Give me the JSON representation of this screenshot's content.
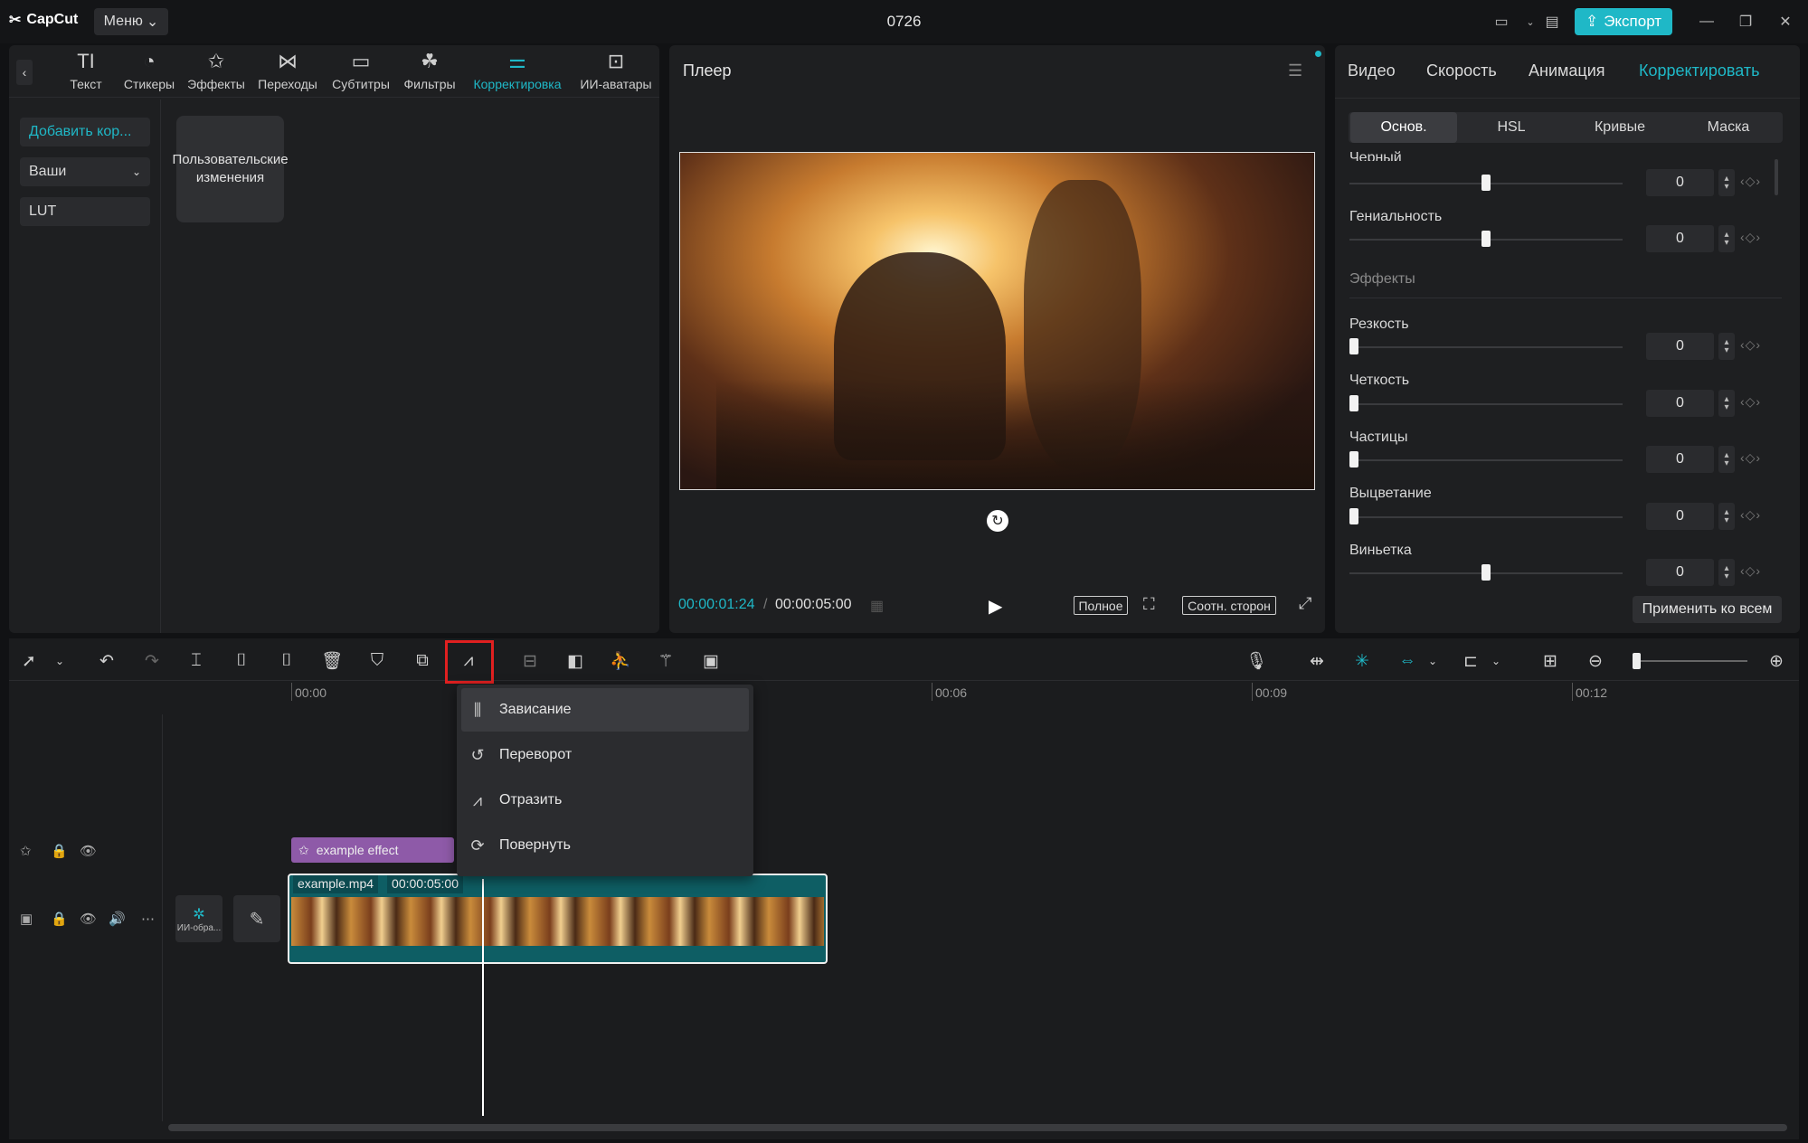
{
  "app": {
    "name": "CapCut",
    "menu_label": "Меню",
    "project_title": "0726",
    "export_label": "Экспорт"
  },
  "toolbar": {
    "items": [
      {
        "label": "Текст",
        "icon": "text-icon"
      },
      {
        "label": "Стикеры",
        "icon": "sticker-icon"
      },
      {
        "label": "Эффекты",
        "icon": "effects-icon"
      },
      {
        "label": "Переходы",
        "icon": "transitions-icon"
      },
      {
        "label": "Субтитры",
        "icon": "subtitles-icon"
      },
      {
        "label": "Фильтры",
        "icon": "filters-icon"
      },
      {
        "label": "Корректировка",
        "icon": "adjust-icon",
        "active": true
      },
      {
        "label": "ИИ-аватары",
        "icon": "avatar-icon"
      }
    ]
  },
  "leftnav": {
    "add_label": "Добавить кор...",
    "yours_label": "Ваши",
    "lut_label": "LUT"
  },
  "preset_tile": {
    "label": "Пользовательские изменения"
  },
  "player": {
    "title": "Плеер",
    "current_time": "00:00:01:24",
    "total_time": "00:00:05:00",
    "full_label": "Полное",
    "ratio_label": "Соотн. сторон"
  },
  "right": {
    "tabs": [
      "Видео",
      "Скорость",
      "Анимация",
      "Корректировать"
    ],
    "active_tab": "Корректировать",
    "subtabs": [
      "Основ.",
      "HSL",
      "Кривые",
      "Маска"
    ],
    "props_top": [
      {
        "label": "Черный",
        "value": "0",
        "pos": 0.5
      },
      {
        "label": "Гениальность",
        "value": "0",
        "pos": 0.5
      }
    ],
    "section_effects": "Эффекты",
    "props_effects": [
      {
        "label": "Резкость",
        "value": "0",
        "pos": 0
      },
      {
        "label": "Четкость",
        "value": "0",
        "pos": 0
      },
      {
        "label": "Частицы",
        "value": "0",
        "pos": 0
      },
      {
        "label": "Выцветание",
        "value": "0",
        "pos": 0
      },
      {
        "label": "Виньетка",
        "value": "0",
        "pos": 0.5
      }
    ],
    "apply_all": "Применить ко всем"
  },
  "timeline": {
    "ruler": [
      "00:00",
      "00:06",
      "00:09",
      "00:12"
    ],
    "context_menu": [
      "Зависание",
      "Переворот",
      "Отразить",
      "Повернуть"
    ],
    "effect_clip": "example effect",
    "video_clip": {
      "name": "example.mp4",
      "duration": "00:00:05:00"
    },
    "ai_button": "ИИ-обра..."
  },
  "colors": {
    "accent": "#1fb8c7",
    "highlight": "#e02020",
    "effect_clip": "#8e5aa8",
    "video_clip": "#0e5e64"
  }
}
